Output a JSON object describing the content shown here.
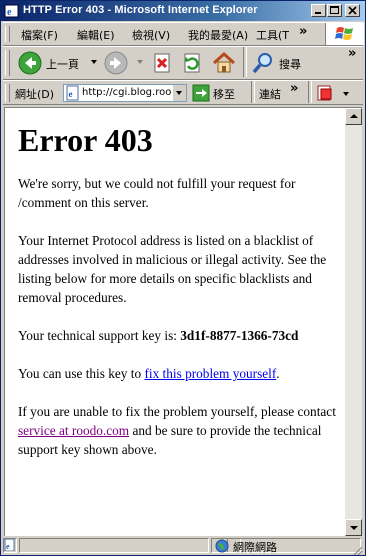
{
  "window": {
    "title": "HTTP Error 403 - Microsoft Internet Explorer"
  },
  "menu": {
    "items": [
      "檔案(F)",
      "編輯(E)",
      "檢視(V)",
      "我的最愛(A)",
      "工具(T"
    ],
    "overflow": "»"
  },
  "toolbar": {
    "back_label": "上一頁",
    "search_label": "搜尋",
    "overflow": "»"
  },
  "address": {
    "label": "網址(D)",
    "url": "http://cgi.blog.rood",
    "go_label": "移至",
    "links_label": "連結",
    "overflow": "»"
  },
  "page": {
    "heading": "Error 403",
    "p1": "We're sorry, but we could not fulfill your request for /comment on this server.",
    "p2": "Your Internet Protocol address is listed on a blacklist of addresses involved in malicious or illegal activity. See the listing below for more details on specific blacklists and removal procedures.",
    "p3_text": "Your technical support key is: ",
    "support_key": "3d1f-8877-1366-73cd",
    "p4_text": "You can use this key to ",
    "fix_link": "fix this problem yourself",
    "p4_end": ".",
    "p5_text": "If you are unable to fix the problem yourself, please contact ",
    "contact_link": "service at roodo.com",
    "p5_end": " and be sure to provide the technical support key shown above."
  },
  "status": {
    "zone": "網際網路"
  },
  "icons": [
    "ie-icon",
    "minimize-icon",
    "maximize-icon",
    "close-icon",
    "windows-logo-icon",
    "back-arrow-icon",
    "forward-arrow-icon",
    "stop-icon",
    "refresh-icon",
    "home-icon",
    "search-icon",
    "page-icon",
    "go-arrow-icon",
    "favorites-icon",
    "globe-icon"
  ],
  "colors": {
    "title_start": "#0a246a",
    "title_end": "#a6caf0",
    "link": "#0000ee",
    "visited_link": "#800080"
  }
}
